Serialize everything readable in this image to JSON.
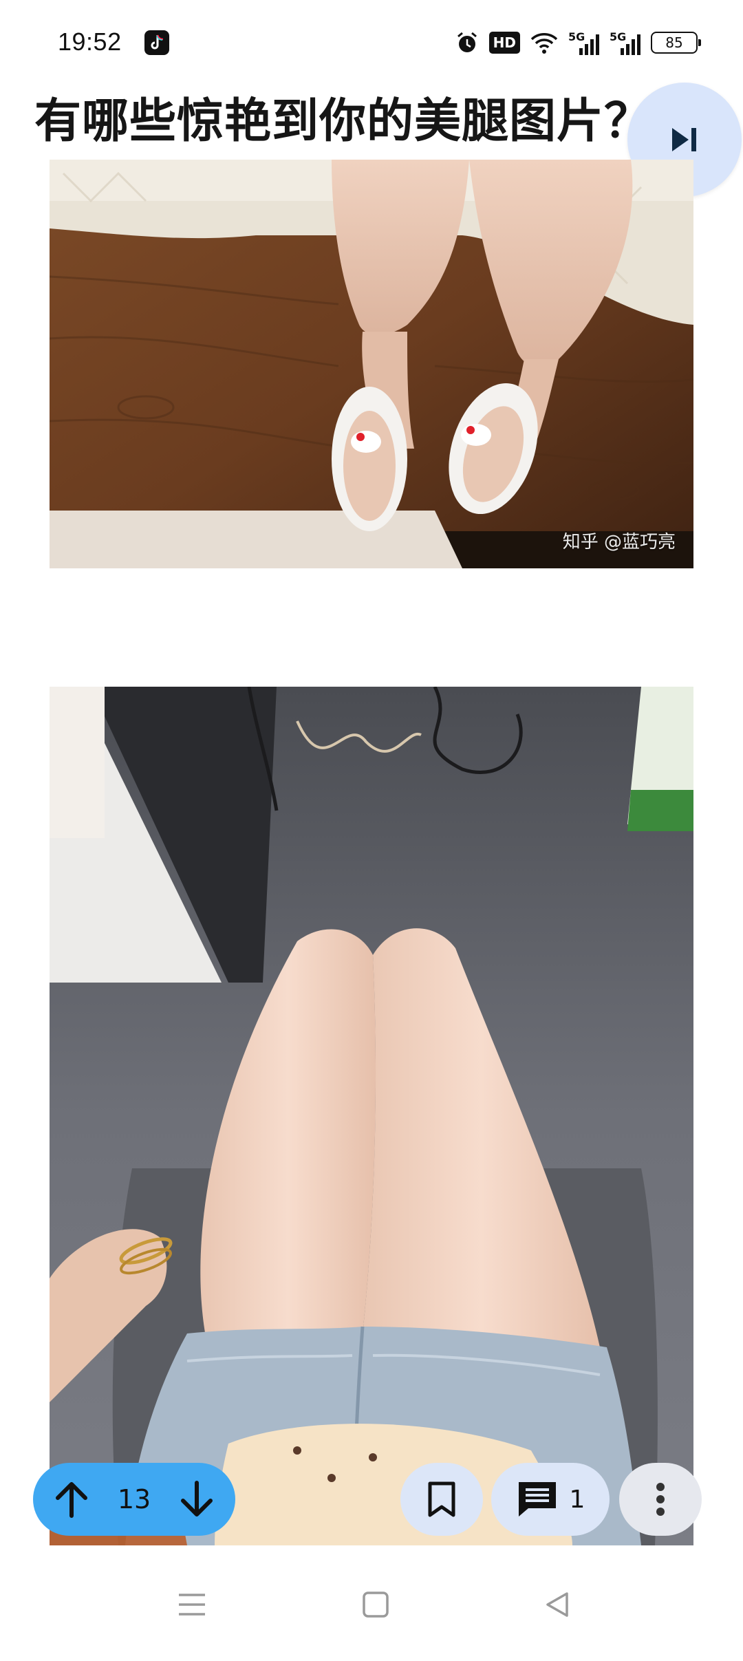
{
  "status_bar": {
    "time": "19:52",
    "app_icon": "tiktok-icon",
    "hd_label": "HD",
    "signal_1_label": "5G",
    "signal_2_label": "5G",
    "battery": "85"
  },
  "question": {
    "title": "有哪些惊艳到你的美腿图片？"
  },
  "images": [
    {
      "watermark": "知乎 @蓝巧亮"
    },
    {
      "watermark": "@"
    }
  ],
  "toolbar": {
    "answer_count": "13",
    "comment_count": "1",
    "icons": {
      "up": "arrow-up-icon",
      "down": "arrow-down-icon",
      "bookmark": "bookmark-icon",
      "comment": "comment-icon",
      "more": "more-vertical-icon",
      "next": "skip-next-icon"
    }
  },
  "colors": {
    "nav_pill": "#3fa8f2",
    "action_button": "#dce6f8",
    "fab": "#d9e5fb"
  }
}
